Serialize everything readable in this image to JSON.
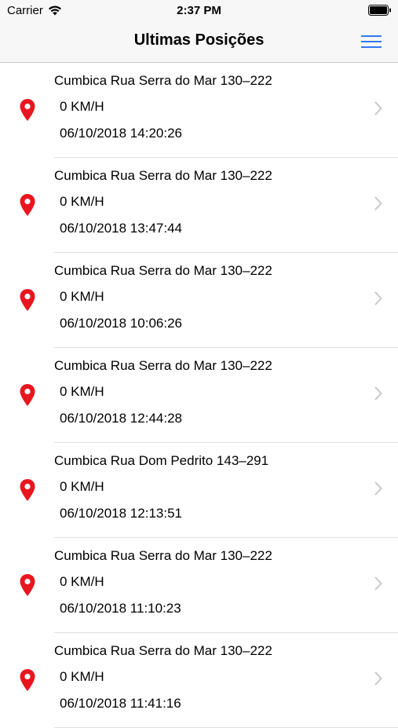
{
  "status_bar": {
    "carrier": "Carrier",
    "time": "2:37 PM"
  },
  "nav": {
    "title": "Ultimas Posições",
    "menu_icon": "hamburger-menu-icon"
  },
  "colors": {
    "pin": "#e8161e",
    "accent": "#3478f6",
    "chevron": "#c7c7cc"
  },
  "positions": [
    {
      "address": "Cumbica Rua Serra do Mar 130–222",
      "speed": "0 KM/H",
      "datetime": "06/10/2018 14:20:26"
    },
    {
      "address": "Cumbica Rua Serra do Mar 130–222",
      "speed": "0 KM/H",
      "datetime": "06/10/2018 13:47:44"
    },
    {
      "address": "Cumbica Rua Serra do Mar 130–222",
      "speed": "0 KM/H",
      "datetime": "06/10/2018 10:06:26"
    },
    {
      "address": "Cumbica Rua Serra do Mar 130–222",
      "speed": "0 KM/H",
      "datetime": "06/10/2018 12:44:28"
    },
    {
      "address": "Cumbica Rua Dom Pedrito 143–291",
      "speed": "0 KM/H",
      "datetime": "06/10/2018 12:13:51"
    },
    {
      "address": "Cumbica Rua Serra do Mar 130–222",
      "speed": "0 KM/H",
      "datetime": "06/10/2018 11:10:23"
    },
    {
      "address": "Cumbica Rua Serra do Mar 130–222",
      "speed": "0 KM/H",
      "datetime": "06/10/2018 11:41:16"
    }
  ]
}
